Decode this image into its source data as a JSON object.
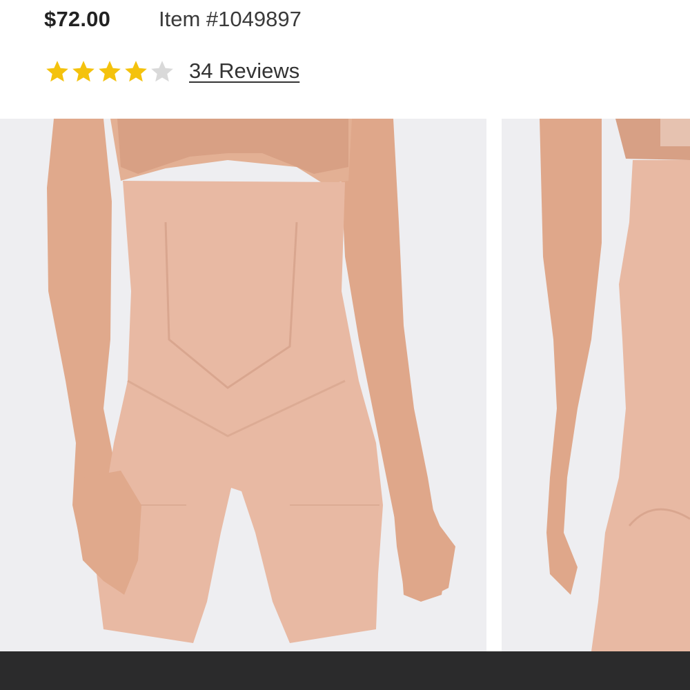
{
  "product": {
    "price": "$72.00",
    "item_number": "Item #1049897",
    "rating": {
      "value": 4,
      "max": 5,
      "filled_color": "#f4c20d",
      "empty_color": "#d9d9d9"
    },
    "reviews_link": "34 Reviews"
  },
  "gallery": {
    "images": [
      {
        "name": "front-view-photo"
      },
      {
        "name": "back-view-photo"
      }
    ],
    "colors": {
      "background": "#eeeef1",
      "skin": "#e2ab8e",
      "garment": "#e8b9a3"
    }
  },
  "footer_bar": {
    "color": "#2b2b2c"
  }
}
